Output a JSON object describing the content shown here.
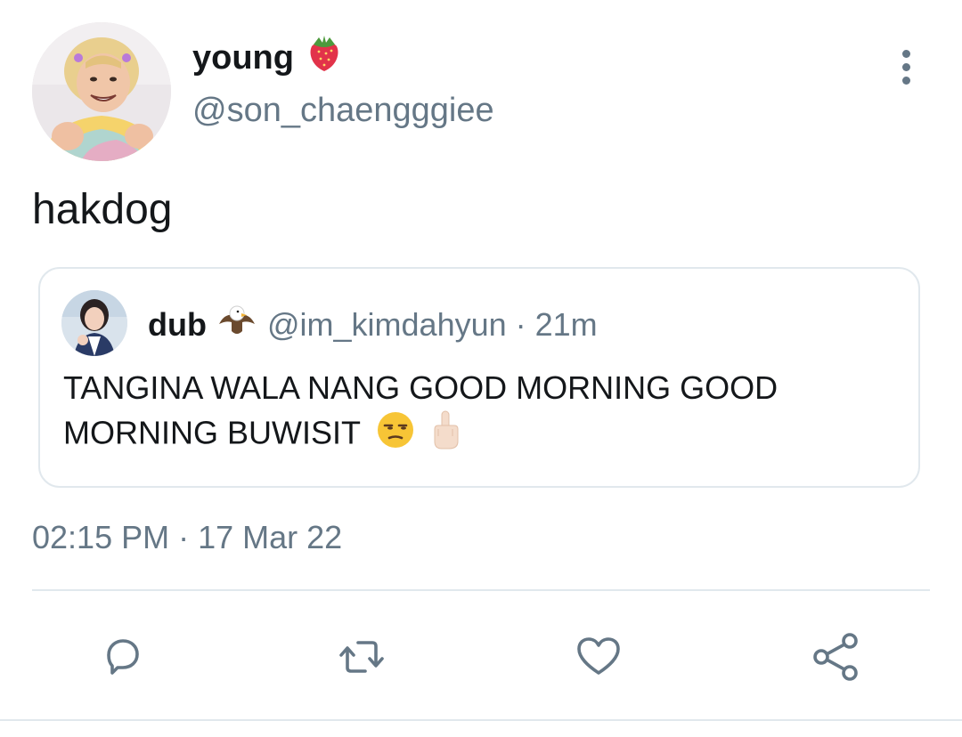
{
  "tweet": {
    "display_name": "young",
    "name_emoji": "strawberry-icon",
    "handle": "@son_chaengggiee",
    "text": "hakdog",
    "timestamp": "02:15 PM · 17 Mar 22"
  },
  "quote": {
    "display_name": "dub",
    "name_emoji": "eagle-icon",
    "handle": "@im_kimdahyun",
    "separator": "·",
    "time": "21m",
    "text": "TANGINA WALA NANG GOOD MORNING GOOD MORNING BUWISIT",
    "text_emojis": [
      "unamused-face-icon",
      "middle-finger-icon"
    ]
  },
  "actions": [
    "reply-icon",
    "retweet-icon",
    "like-icon",
    "share-icon"
  ],
  "colors": {
    "text_primary": "#14171a",
    "text_secondary": "#657786",
    "border": "#e1e8ed"
  }
}
